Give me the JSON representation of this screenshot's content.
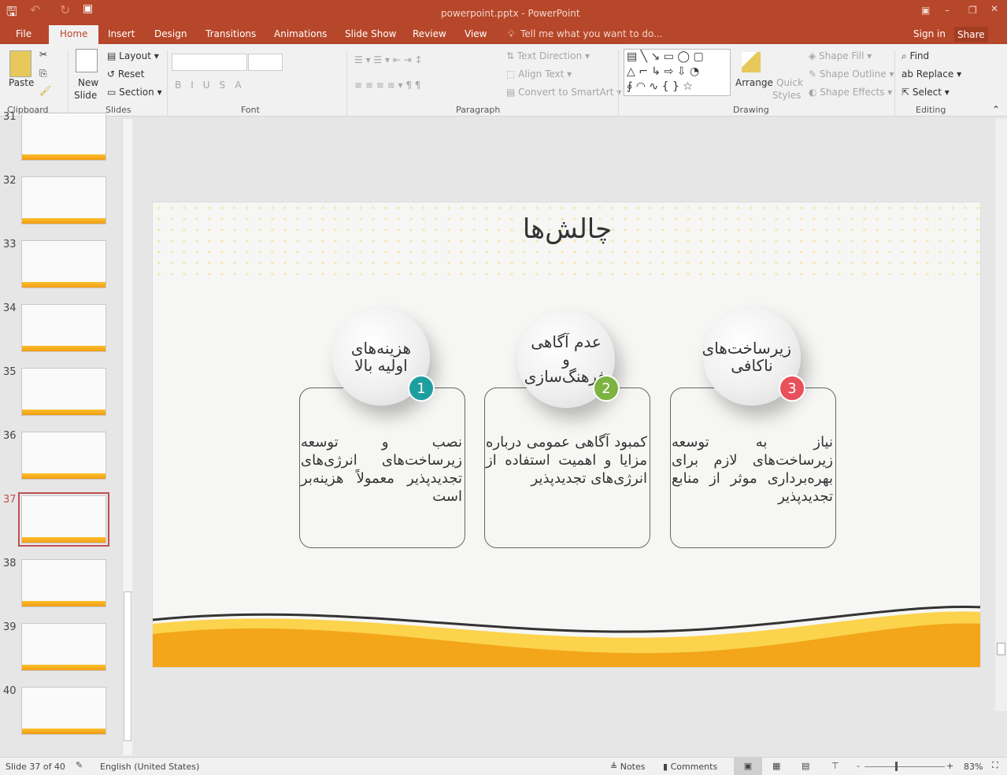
{
  "titlebar": {
    "title": "powerpoint.pptx - PowerPoint"
  },
  "tabs": [
    "File",
    "Home",
    "Insert",
    "Design",
    "Transitions",
    "Animations",
    "Slide Show",
    "Review",
    "View"
  ],
  "tell_me": "Tell me what you want to do...",
  "sign_in": "Sign in",
  "share": "Share",
  "ribbon": {
    "clipboard": {
      "paste": "Paste",
      "label": "Clipboard"
    },
    "slides": {
      "new_slide": "New",
      "new_slide2": "Slide",
      "layout": "Layout",
      "reset": "Reset",
      "section": "Section",
      "label": "Slides"
    },
    "font": {
      "label": "Font"
    },
    "paragraph": {
      "text_direction": "Text Direction",
      "align_text": "Align Text",
      "smartart": "Convert to SmartArt",
      "label": "Paragraph"
    },
    "drawing": {
      "arrange": "Arrange",
      "quick": "Quick",
      "styles": "Styles",
      "fill": "Shape Fill",
      "outline": "Shape Outline",
      "effects": "Shape Effects",
      "label": "Drawing"
    },
    "editing": {
      "find": "Find",
      "replace": "Replace",
      "select": "Select",
      "label": "Editing"
    }
  },
  "thumbs": [
    "31",
    "32",
    "33",
    "34",
    "35",
    "36",
    "37",
    "38",
    "39",
    "40"
  ],
  "selected_slide": "37",
  "slide": {
    "title": "چالش‌ها",
    "cards": [
      {
        "num": "1",
        "heading": "هزینه‌های اولیه بالا",
        "body": "نصب و توسعه زیرساخت‌های انرژی‌های تجدیدپذیر معمولاً هزینه‌بر است",
        "color": "#1f9ea0"
      },
      {
        "num": "2",
        "heading": "عدم آگاهی و فرهنگ‌سازی",
        "body": "کمبود آگاهی عمومی درباره مزایا و اهمیت استفاده از انرژی‌های تجدیدپذیر",
        "color": "#7cb342"
      },
      {
        "num": "3",
        "heading": "زیرساخت‌های ناکافی",
        "body": "نیاز به توسعه زیرساخت‌های لازم برای بهره‌برداری موثر از منابع تجدیدپذیر",
        "color": "#e8505b"
      }
    ]
  },
  "status": {
    "slide": "Slide 37 of 40",
    "language": "English (United States)",
    "notes": "Notes",
    "comments": "Comments",
    "zoom": "83%"
  },
  "colors": {
    "accent": "#b7472a"
  }
}
